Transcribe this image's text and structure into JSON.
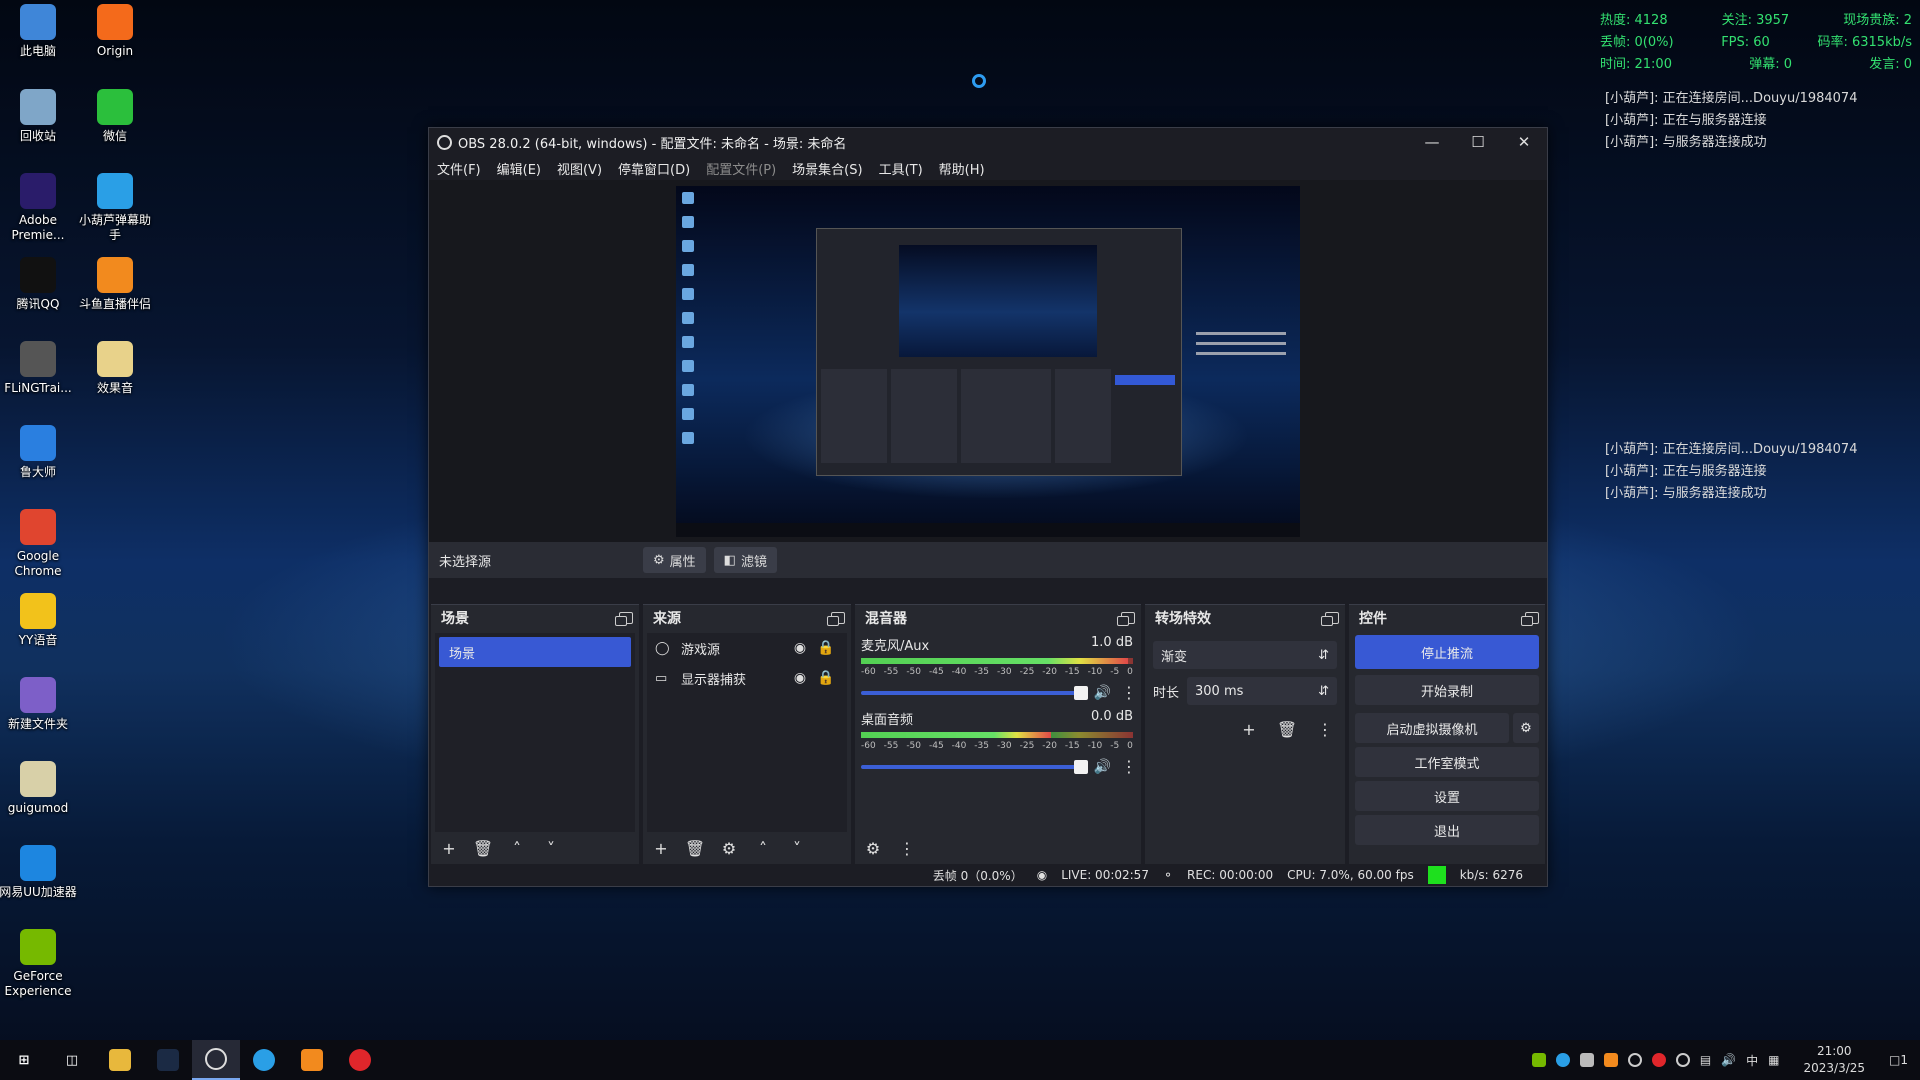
{
  "desktop": {
    "icons": [
      {
        "label": "此电脑",
        "icon": "computer-icon",
        "color": "#3f86d8"
      },
      {
        "label": "Origin",
        "icon": "origin-icon",
        "color": "#f46a1b"
      },
      {
        "label": "回收站",
        "icon": "recycle-bin-icon",
        "color": "#7fa6c8"
      },
      {
        "label": "微信",
        "icon": "wechat-icon",
        "color": "#2bbf3c"
      },
      {
        "label": "Adobe Premie...",
        "icon": "premiere-icon",
        "color": "#2a1c6a"
      },
      {
        "label": "小葫芦弹幕助手",
        "icon": "xiaohulu-icon",
        "color": "#2a9fe6"
      },
      {
        "label": "腾讯QQ",
        "icon": "qq-icon",
        "color": "#111111"
      },
      {
        "label": "斗鱼直播伴侣",
        "icon": "douyu-icon",
        "color": "#f28a1e"
      },
      {
        "label": "FLiNGTrai...",
        "icon": "fling-trainer-icon",
        "color": "#555555"
      },
      {
        "label": "效果音",
        "icon": "folder-icon",
        "color": "#e8d28a"
      },
      {
        "label": "鲁大师",
        "icon": "ludashi-icon",
        "color": "#2a7fe0"
      },
      {
        "label": "Google Chrome",
        "icon": "chrome-icon",
        "color": "#e0452f"
      },
      {
        "label": "YY语音",
        "icon": "yy-icon",
        "color": "#f2c21b"
      },
      {
        "label": "新建文件夹",
        "icon": "new-folder-icon",
        "color": "#7d5fc8"
      },
      {
        "label": "guigumod",
        "icon": "guigumod-icon",
        "color": "#d8d0a8"
      },
      {
        "label": "网易UU加速器",
        "icon": "uu-icon",
        "color": "#1d86e0"
      },
      {
        "label": "GeForce Experience",
        "icon": "geforce-icon",
        "color": "#76b900"
      }
    ]
  },
  "overlay": {
    "stats": [
      [
        "热度: 4128",
        "关注: 3957",
        "现场贵族: 2"
      ],
      [
        "丢帧: 0(0%)",
        "FPS: 60",
        "码率: 6315kb/s"
      ],
      [
        "时间: 21:00",
        "弹幕: 0",
        "发言: 0"
      ]
    ],
    "chat_top": [
      "[小葫芦]: 正在连接房间...Douyu/1984074",
      "[小葫芦]: 正在与服务器连接",
      "[小葫芦]: 与服务器连接成功"
    ],
    "chat_mid": [
      "[小葫芦]: 正在连接房间...Douyu/1984074",
      "[小葫芦]: 正在与服务器连接",
      "[小葫芦]: 与服务器连接成功"
    ],
    "colors": {
      "stats": "#33e070"
    }
  },
  "obs": {
    "title": "OBS 28.0.2 (64-bit, windows) - 配置文件: 未命名 - 场景: 未命名",
    "menu": [
      "文件(F)",
      "编辑(E)",
      "视图(V)",
      "停靠窗口(D)",
      "配置文件(P)",
      "场景集合(S)",
      "工具(T)",
      "帮助(H)"
    ],
    "source_bar": {
      "no_source": "未选择源",
      "properties": "属性",
      "filters": "滤镜"
    },
    "scenes": {
      "title": "场景",
      "items": [
        "场景"
      ]
    },
    "sources": {
      "title": "来源",
      "items": [
        {
          "label": "游戏源",
          "icon": "gamepad-icon"
        },
        {
          "label": "显示器捕获",
          "icon": "monitor-icon"
        }
      ]
    },
    "mixer": {
      "title": "混音器",
      "channels": [
        {
          "name": "麦克风/Aux",
          "db": "1.0 dB",
          "level": 0.98,
          "volume": 1.0
        },
        {
          "name": "桌面音频",
          "db": "0.0 dB",
          "level": 0.7,
          "volume": 1.0
        }
      ],
      "ticks": [
        "-60",
        "-55",
        "-50",
        "-45",
        "-40",
        "-35",
        "-30",
        "-25",
        "-20",
        "-15",
        "-10",
        "-5",
        "0"
      ]
    },
    "transitions": {
      "title": "转场特效",
      "selected": "渐变",
      "duration_label": "时长",
      "duration": "300 ms"
    },
    "controls": {
      "title": "控件",
      "buttons": [
        "停止推流",
        "开始录制",
        "启动虚拟摄像机",
        "工作室模式",
        "设置",
        "退出"
      ]
    },
    "status": {
      "dropped": "丢帧 0（0.0%）",
      "live": "LIVE: 00:02:57",
      "rec": "REC: 00:00:00",
      "cpu": "CPU: 7.0%, 60.00 fps",
      "kbs": "kb/s: 6276"
    },
    "colors": {
      "accent": "#3859d4",
      "status_ok": "#1ee01e"
    }
  },
  "taskbar": {
    "clock_time": "21:00",
    "clock_date": "2023/3/25",
    "ime": "中",
    "notifications": "1"
  }
}
